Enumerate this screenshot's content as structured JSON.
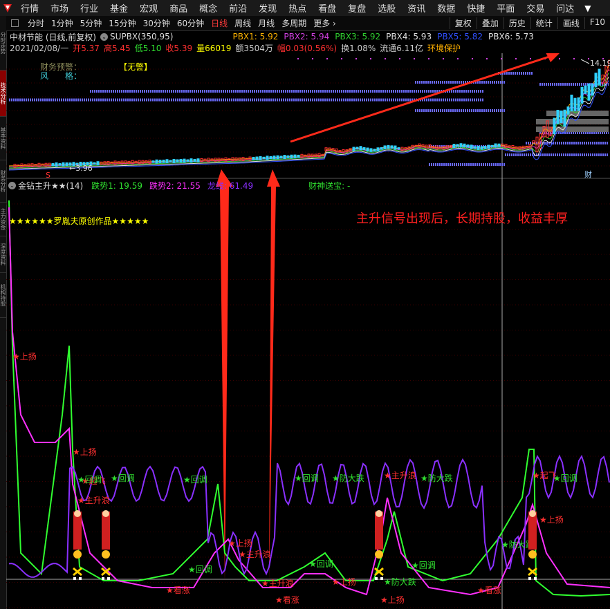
{
  "menu": {
    "items": [
      "行情",
      "市场",
      "行业",
      "基金",
      "宏观",
      "商品",
      "概念",
      "前沿",
      "发现",
      "热点",
      "看盘",
      "复盘",
      "选股",
      "资讯",
      "数据",
      "快捷",
      "平面",
      "交易",
      "问达"
    ],
    "more_arrow": "▼"
  },
  "leftbar": {
    "tabs": [
      "分时走势",
      "技术分析",
      "基本资料",
      "财务分析",
      "主力资金",
      "深度资料",
      "机构持股"
    ]
  },
  "toolbar": {
    "periods": [
      "分时",
      "1分钟",
      "5分钟",
      "15分钟",
      "30分钟",
      "60分钟",
      "日线",
      "周线",
      "月线",
      "多周期",
      "更多 ›"
    ],
    "active_index": 6,
    "right": [
      "复权",
      "叠加",
      "历史",
      "统计",
      "画线",
      "F10"
    ]
  },
  "stock": {
    "title": "中材节能 (日线,前复权)",
    "indicator": "SUPBX(350,95)",
    "pbx": [
      {
        "label": "PBX1: 5.92",
        "color": "#ffb400"
      },
      {
        "label": "PBX2: 5.94",
        "color": "#d040e0"
      },
      {
        "label": "PBX3: 5.92",
        "color": "#30d030"
      },
      {
        "label": "PBX4: 5.93",
        "color": "#e0e0e0"
      },
      {
        "label": "PBX5: 5.82",
        "color": "#3050ff"
      },
      {
        "label": "PBX6: 5.73",
        "color": "#e0e0e0"
      }
    ]
  },
  "quote": {
    "date": "2021/02/08/一",
    "open": "开5.37",
    "high": "高5.45",
    "low": "低5.10",
    "close": "收5.39",
    "volume": "量66019",
    "amount": "额3504万",
    "change": "幅0.03(0.56%)",
    "turnover": "换1.08%",
    "float": "流通6.11亿",
    "tag": "环境保护"
  },
  "warning": {
    "label1": "财务预警：",
    "label2": "风　　格：",
    "value": "【无警】"
  },
  "price_labels": {
    "high": "14.19",
    "low": "3.96",
    "marker_s": "S",
    "marker_cai": "财"
  },
  "indicator_panel": {
    "name": "金钻主升★★(14)",
    "values": [
      {
        "label": "跌势1: 19.59",
        "color": "#30e030"
      },
      {
        "label": "跌势2: 21.55",
        "color": "#ff30ff"
      },
      {
        "label": "龙线: 61.49",
        "color": "#8a30ff"
      },
      {
        "label": "财神送宝: -",
        "color": "#30e030"
      }
    ],
    "author": "★★★★★★罗胤夫原创作品★★★★★",
    "banner": "主升信号出现后，长期持股，收益丰厚"
  },
  "signals": {
    "red": [
      "上扬",
      "上扬",
      "主升浪",
      "起飞",
      "看涨",
      "上扬",
      "主升浪",
      "主升浪",
      "看涨",
      "上扬",
      "上扬",
      "主升浪",
      "看涨",
      "起飞",
      "上扬"
    ],
    "green": [
      "回调",
      "回调",
      "回调",
      "回调",
      "防大跌",
      "防大跌",
      "回调",
      "回调",
      "回调",
      "防大跌",
      "防大跌",
      "回调"
    ]
  },
  "colors": {
    "up": "#ff3030",
    "down": "#30d0ff",
    "arrow": "#ff2a1a",
    "green_line": "#30ff30",
    "magenta_line": "#ff30ff",
    "purple_line": "#8a30ff",
    "yellow": "#ffff00"
  }
}
